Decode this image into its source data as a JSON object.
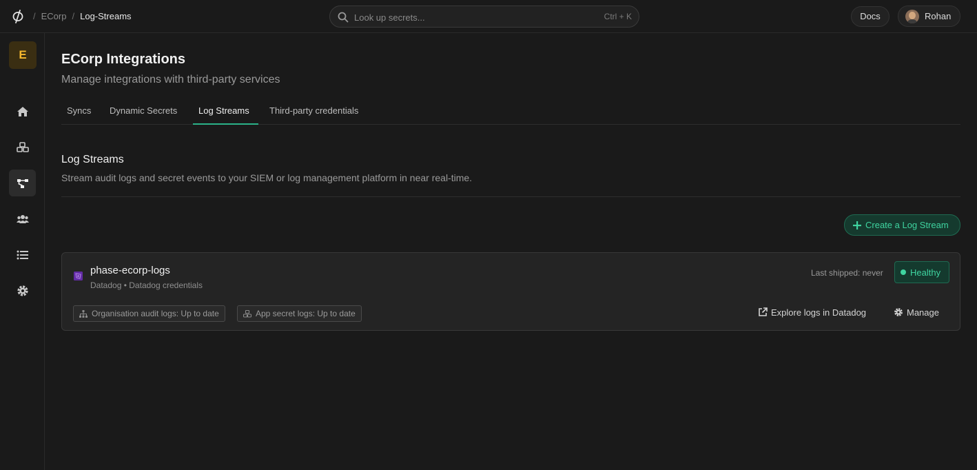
{
  "breadcrumbs": {
    "org": "ECorp",
    "page": "Log-Streams",
    "separator": "/"
  },
  "search": {
    "placeholder": "Look up secrets...",
    "shortcut": "Ctrl + K"
  },
  "header": {
    "docs_label": "Docs",
    "user_name": "Rohan"
  },
  "sidebar": {
    "org_initial": "E",
    "items": [
      "home-icon",
      "apps-icon",
      "integrations-icon",
      "members-icon",
      "logs-icon",
      "settings-icon"
    ],
    "active_index": 2
  },
  "page": {
    "title": "ECorp Integrations",
    "subtitle": "Manage integrations with third-party services"
  },
  "tabs": [
    {
      "label": "Syncs"
    },
    {
      "label": "Dynamic Secrets"
    },
    {
      "label": "Log Streams"
    },
    {
      "label": "Third-party credentials"
    }
  ],
  "active_tab": 2,
  "section": {
    "title": "Log Streams",
    "description": "Stream audit logs and secret events to your SIEM or log management platform in near real-time."
  },
  "create_button": {
    "label": "Create a Log Stream"
  },
  "stream": {
    "name": "phase-ecorp-logs",
    "provider": "Datadog",
    "credentials": "Datadog credentials",
    "meta_separator": "•",
    "last_shipped": "Last shipped: never",
    "status": "Healthy",
    "org_audit_pill": "Organisation audit logs: Up to date",
    "app_secret_pill": "App secret logs: Up to date",
    "explore_label": "Explore logs in Datadog",
    "manage_label": "Manage"
  },
  "colors": {
    "accent": "#3fd4a0",
    "brand_badge": "#f5b82e",
    "datadog": "#632ca6",
    "background": "#1a1a1a"
  }
}
